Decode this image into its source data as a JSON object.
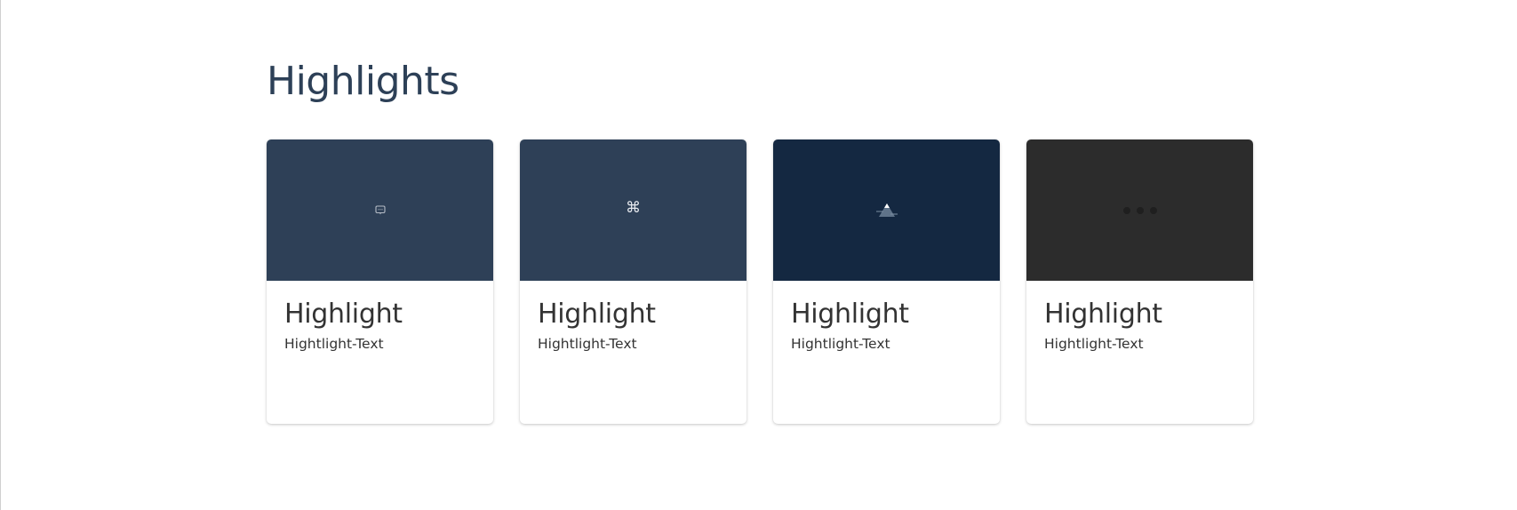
{
  "section": {
    "title": "Highlights"
  },
  "cards": [
    {
      "title": "Highlight",
      "text": "Hightlight-Text",
      "icon": "chat-bubble-icon",
      "bg": "#2e4057"
    },
    {
      "title": "Highlight",
      "text": "Hightlight-Text",
      "icon": "command-key-icon",
      "bg": "#2e4057",
      "glyph": "⌘"
    },
    {
      "title": "Highlight",
      "text": "Hightlight-Text",
      "icon": "mountain-icon",
      "bg": "#142841"
    },
    {
      "title": "Highlight",
      "text": "Hightlight-Text",
      "icon": "ellipsis-icon",
      "bg": "#2c2c2c"
    }
  ]
}
